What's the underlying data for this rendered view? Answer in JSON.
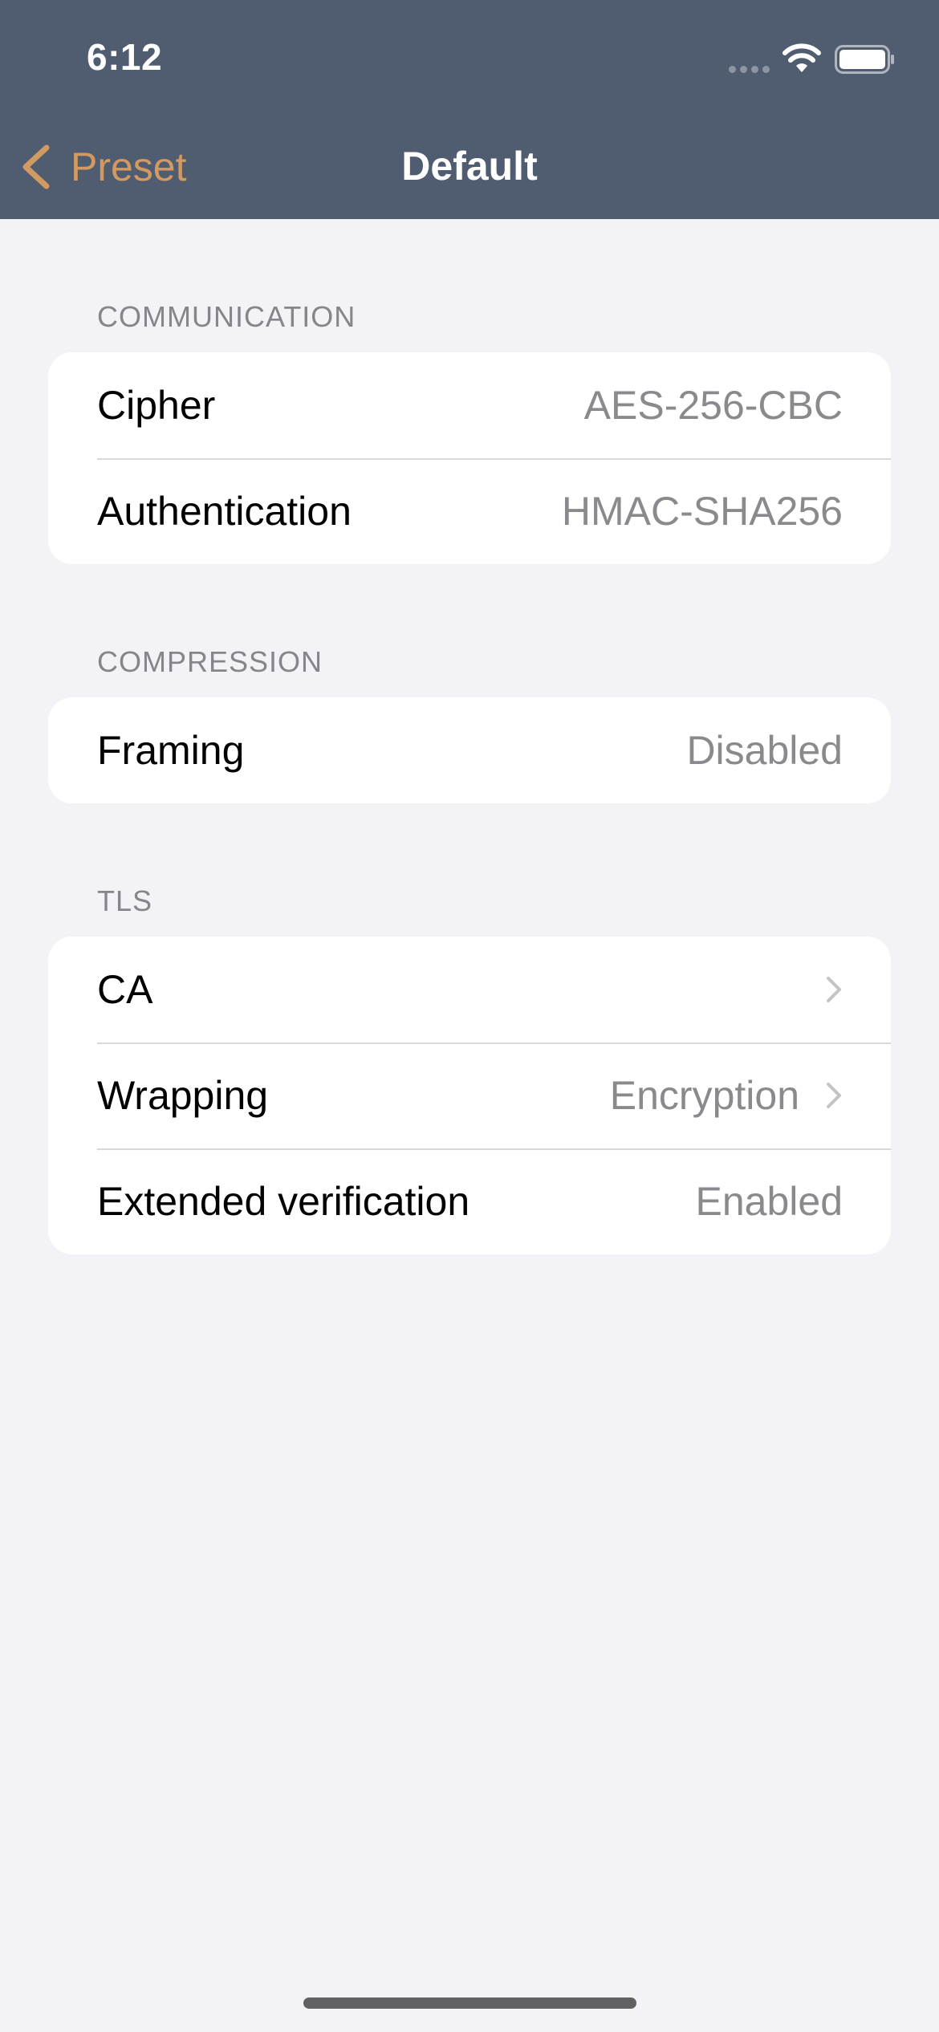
{
  "status_bar": {
    "time": "6:12"
  },
  "nav": {
    "back_label": "Preset",
    "title": "Default",
    "accent_color": "#d29a62",
    "bar_color": "#505d71"
  },
  "sections": {
    "communication": {
      "header": "COMMUNICATION",
      "rows": [
        {
          "label": "Cipher",
          "value": "AES-256-CBC"
        },
        {
          "label": "Authentication",
          "value": "HMAC-SHA256"
        }
      ]
    },
    "compression": {
      "header": "COMPRESSION",
      "rows": [
        {
          "label": "Framing",
          "value": "Disabled"
        }
      ]
    },
    "tls": {
      "header": "TLS",
      "rows": [
        {
          "label": "CA",
          "value": "",
          "icon": "chevron-right-icon"
        },
        {
          "label": "Wrapping",
          "value": "Encryption",
          "icon": "chevron-right-icon"
        },
        {
          "label": "Extended verification",
          "value": "Enabled"
        }
      ]
    }
  }
}
